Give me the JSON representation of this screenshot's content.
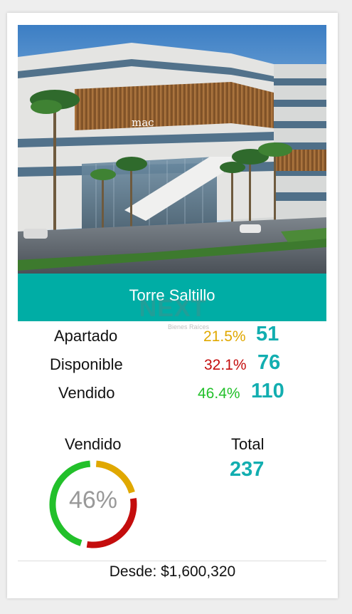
{
  "property": {
    "name": "Torre Saltillo",
    "building_sign": "mac",
    "price_text": "Desde: $1,600,320"
  },
  "watermark": {
    "logo_text": "NEXT",
    "subtitle": "Bienes Raíces"
  },
  "stats": [
    {
      "label": "Apartado",
      "percent": "21.5%",
      "count": "51",
      "color": "#e0a800"
    },
    {
      "label": "Disponible",
      "percent": "32.1%",
      "count": "76",
      "color": "#c40d0d"
    },
    {
      "label": "Vendido",
      "percent": "46.4%",
      "count": "110",
      "color": "#22c02a"
    }
  ],
  "summary": {
    "sold_title": "Vendido",
    "sold_percent_text": "46%",
    "sold_fraction": 0.464,
    "available_fraction": 0.321,
    "reserved_fraction": 0.215,
    "total_title": "Total",
    "total_value": "237"
  },
  "colors": {
    "accent": "#00ada5",
    "count_teal": "#12aeb0",
    "reserved": "#e0a800",
    "available": "#c40d0d",
    "sold": "#22c02a"
  }
}
